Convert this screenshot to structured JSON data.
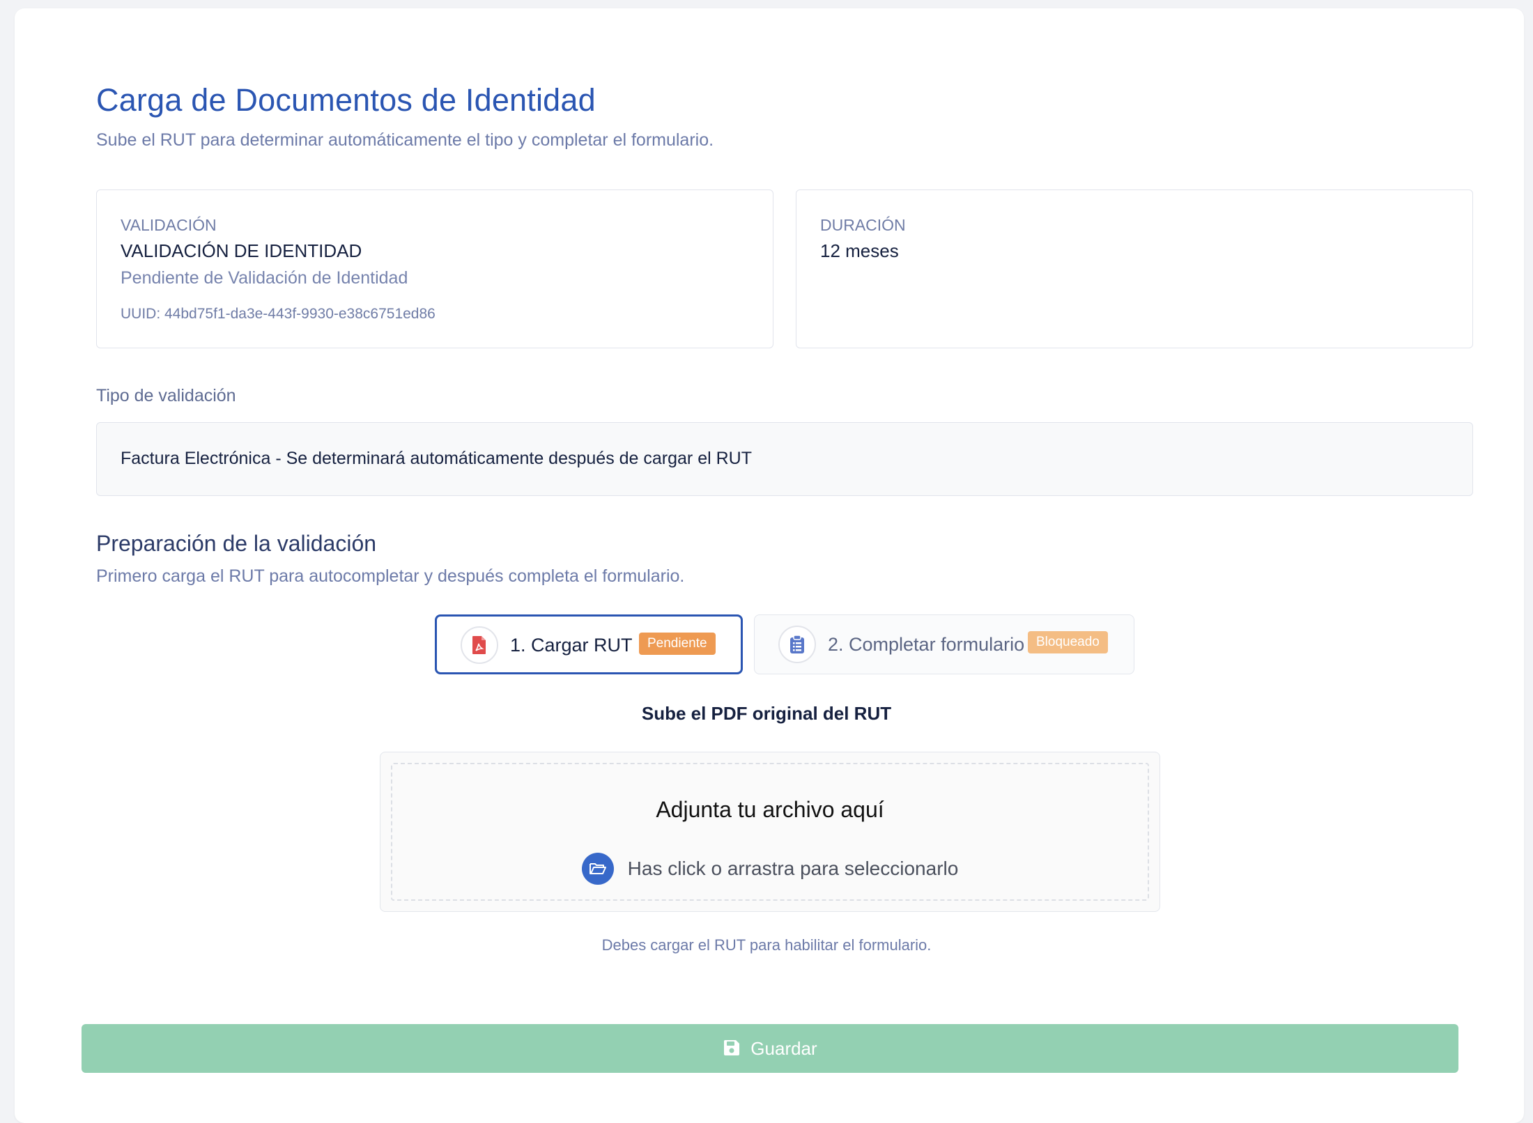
{
  "header": {
    "title": "Carga de Documentos de Identidad",
    "subtitle": "Sube el RUT para determinar automáticamente el tipo y completar el formulario."
  },
  "validation_card": {
    "label": "VALIDACIÓN",
    "value": "VALIDACIÓN DE IDENTIDAD",
    "status": "Pendiente de Validación de Identidad",
    "uuid": "UUID: 44bd75f1-da3e-443f-9930-e38c6751ed86"
  },
  "duration_card": {
    "label": "DURACIÓN",
    "value": "12 meses"
  },
  "validation_type": {
    "label": "Tipo de validación",
    "value": "Factura Electrónica - Se determinará automáticamente después de cargar el RUT"
  },
  "preparation": {
    "title": "Preparación de la validación",
    "subtitle": "Primero carga el RUT para autocompletar y después completa el formulario.",
    "steps": [
      {
        "label": "1. Cargar RUT",
        "badge": "Pendiente",
        "icon": "pdf-file-icon",
        "badge_color": "#ee9a52"
      },
      {
        "label": "2. Completar formulario",
        "badge": "Bloqueado",
        "icon": "clipboard-icon",
        "badge_color": "#f4bd84"
      }
    ]
  },
  "upload": {
    "title": "Sube el PDF original del RUT",
    "dropzone_title": "Adjunta tu archivo aquí",
    "dropzone_hint": "Has click o arrastra para seleccionarlo",
    "helper": "Debes cargar el RUT para habilitar el formulario."
  },
  "actions": {
    "save_label": "Guardar"
  },
  "colors": {
    "accent": "#2a55b2",
    "save_button": "#93d0b2",
    "pending_badge": "#ee9a52",
    "locked_badge": "#f4bd84"
  }
}
